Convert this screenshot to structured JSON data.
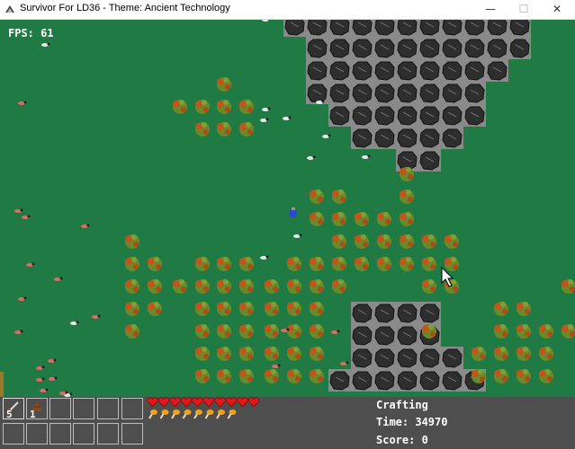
{
  "window": {
    "title": "Survivor For LD36 - Theme: Ancient Technology",
    "minimize": "—",
    "maximize": "☐",
    "close": "✕"
  },
  "hud": {
    "fps_text": "FPS: 61",
    "crafting_label": "Crafting",
    "time_text": "Time: 34970",
    "score_text": "Score: 0",
    "health": 10,
    "hunger": 8,
    "inventory": [
      {
        "icon": "sword-icon",
        "count": "5"
      },
      {
        "icon": "wood-icon",
        "count": "1"
      }
    ]
  },
  "colors": {
    "grass": "#1f7a44",
    "hud": "#4e4e4e",
    "heart": "#e01818",
    "hunger": "#f2a020",
    "rock": "#2e2e2e",
    "tree": "#6a8a2a"
  }
}
